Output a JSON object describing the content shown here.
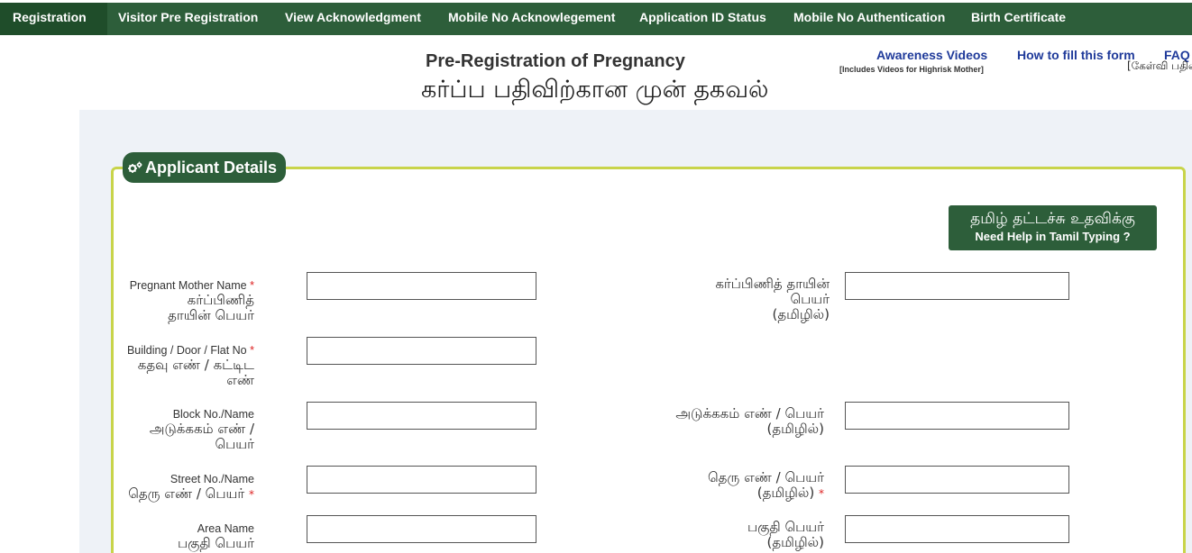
{
  "nav": {
    "items": [
      {
        "label": "Registration",
        "active": true
      },
      {
        "label": "Visitor Pre Registration"
      },
      {
        "label": "View Acknowledgment"
      },
      {
        "label": "Mobile No Acknowlegement"
      },
      {
        "label": "Application ID Status"
      },
      {
        "label": "Mobile No Authentication"
      },
      {
        "label": "Birth Certificate"
      }
    ]
  },
  "header": {
    "title_en": "Pre-Registration of Pregnancy",
    "title_ta": "கர்ப்ப பதிவிற்கான முன் தகவல்",
    "awareness_videos": "Awareness Videos",
    "awareness_sub": "[Includes Videos for Highrisk Mother]",
    "how_to_fill": "How to fill this form",
    "faq": "FAQ",
    "faq_sub": "[கேள்வி பதில்]"
  },
  "section": {
    "legend": "Applicant Details",
    "tamil_help_ta": "தமிழ் தட்டச்சு உதவிக்கு",
    "tamil_help_en": "Need Help in Tamil Typing ?"
  },
  "fields": {
    "mother_name_en": "Pregnant Mother Name",
    "mother_name_ta": "கர்ப்பிணித் தாயின் பெயர்",
    "mother_name_ta_right": "கர்ப்பிணித் தாயின் பெயர்",
    "tamil_suffix": "(தமிழில்)",
    "building_en": "Building / Door / Flat No",
    "building_ta": "கதவு எண் / கட்டிட எண்",
    "block_en": "Block No./Name",
    "block_ta": "அடுக்ககம் எண் / பெயர்",
    "block_ta_right": "அடுக்ககம் எண் / பெயர்",
    "street_en": "Street No./Name",
    "street_ta": "தெரு எண் / பெயர்",
    "street_ta_right": "தெரு எண் / பெயர்",
    "area_en": "Area Name",
    "area_ta": "பகுதி பெயர்",
    "area_ta_right": "பகுதி பெயர்",
    "required_mark": "*"
  },
  "colors": {
    "nav_bg": "#2d5e3a",
    "fieldset_border": "#c8d44a",
    "link": "#1f3a9a"
  }
}
